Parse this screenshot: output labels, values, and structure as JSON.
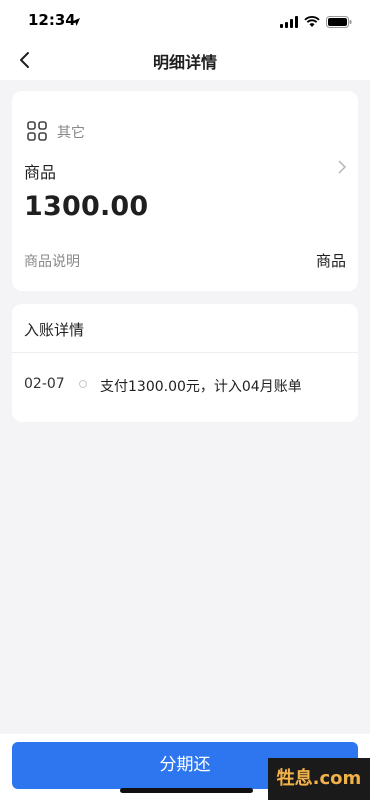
{
  "status_bar": {
    "time": "12:34"
  },
  "nav": {
    "title": "明细详情"
  },
  "detail": {
    "category_label": "其它",
    "item_name": "商品",
    "amount": "1300.00",
    "desc_label": "商品说明",
    "desc_value": "商品"
  },
  "entry": {
    "title": "入账详情",
    "date": "02-07",
    "text": "支付1300.00元，计入04月账单"
  },
  "action": {
    "label": "分期还"
  },
  "watermark": {
    "text": "牲息.com"
  },
  "colors": {
    "primary": "#2d76f0",
    "background": "#f4f4f6"
  }
}
